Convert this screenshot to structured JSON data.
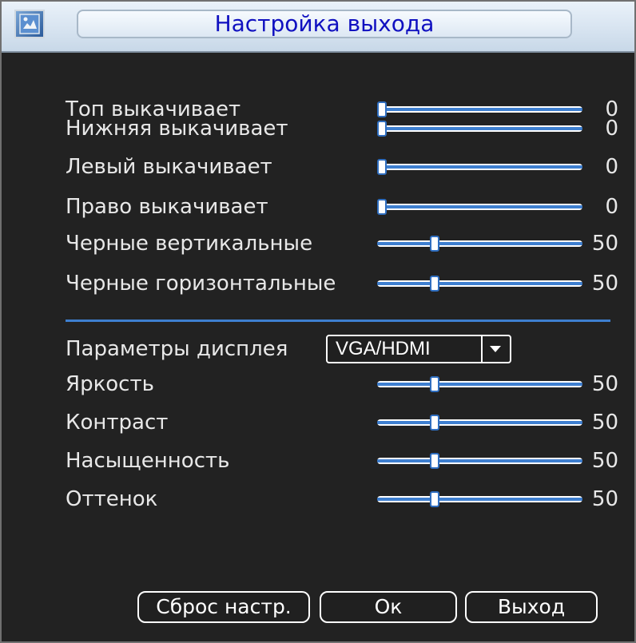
{
  "window": {
    "title": "Настройка выхода"
  },
  "sliders_top": [
    {
      "label": "Топ выкачивает",
      "value": "0",
      "level": 0
    },
    {
      "label": "Нижняя выкачивает",
      "value": "0",
      "level": 0
    },
    {
      "label": "Левый выкачивает",
      "value": "0",
      "level": 0
    },
    {
      "label": "Право выкачивает",
      "value": "0",
      "level": 0
    },
    {
      "label": "Черные вертикальные",
      "value": "50",
      "level": 50
    },
    {
      "label": "Черные горизонтальные",
      "value": "50",
      "level": 50
    }
  ],
  "display_params": {
    "label": "Параметры дисплея",
    "selected": "VGA/HDMI"
  },
  "sliders_bottom": [
    {
      "label": "Яркость",
      "value": "50",
      "level": 50
    },
    {
      "label": "Контраст",
      "value": "50",
      "level": 50
    },
    {
      "label": "Насыщенность",
      "value": "50",
      "level": 50
    },
    {
      "label": "Оттенок",
      "value": "50",
      "level": 50
    }
  ],
  "buttons": {
    "reset": "Сброс настр.",
    "ok": "Ок",
    "exit": "Выход"
  },
  "colors": {
    "accent": "#3e7fd0",
    "title_text": "#1010c0",
    "background": "#222222"
  },
  "icons": {
    "title": "window-app-icon",
    "dropdown": "chevron-down-icon"
  }
}
